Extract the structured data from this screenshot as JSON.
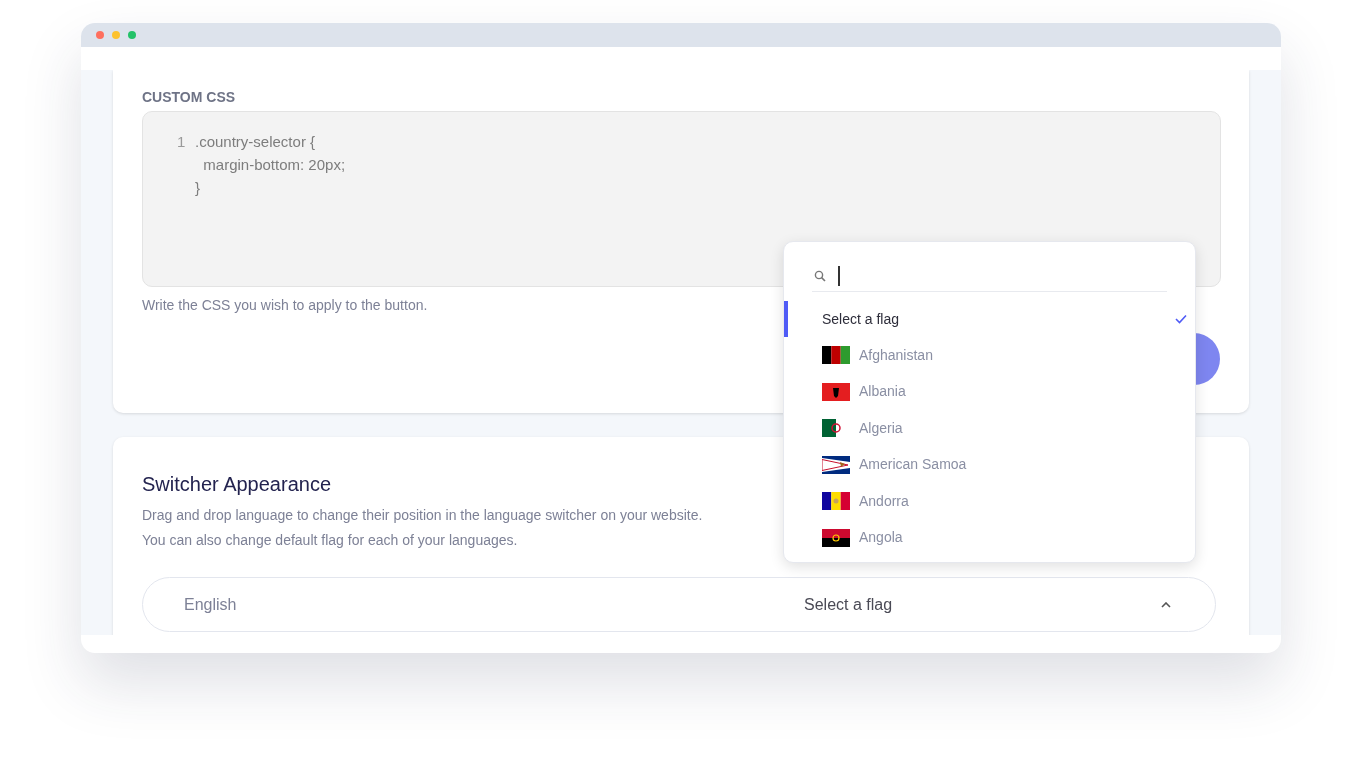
{
  "custom_css": {
    "label": "CUSTOM CSS",
    "lines": [
      {
        "number": "1",
        "text": ".country-selector {"
      },
      {
        "text": "  margin-bottom: 20px;"
      },
      {
        "text": "}"
      }
    ],
    "help": "Write the CSS you wish to apply to the button."
  },
  "switcher": {
    "title": "Switcher Appearance",
    "description": [
      "Drag and drop language to change their position in the language switcher on your website.",
      "You can also change default flag for each of your languages."
    ],
    "row": {
      "language": "English",
      "flag_select": "Select a flag",
      "expanded": true
    }
  },
  "flag_dropdown": {
    "options": [
      {
        "kind": "placeholder",
        "label": "Select a flag",
        "selected": true
      },
      {
        "kind": "country",
        "label": "Afghanistan",
        "selected": false
      },
      {
        "kind": "country",
        "label": "Albania",
        "selected": false
      },
      {
        "kind": "country",
        "label": "Algeria",
        "selected": false
      },
      {
        "kind": "country",
        "label": "American Samoa",
        "selected": false
      },
      {
        "kind": "country",
        "label": "Andorra",
        "selected": false
      },
      {
        "kind": "country",
        "label": "Angola",
        "selected": false
      }
    ]
  }
}
